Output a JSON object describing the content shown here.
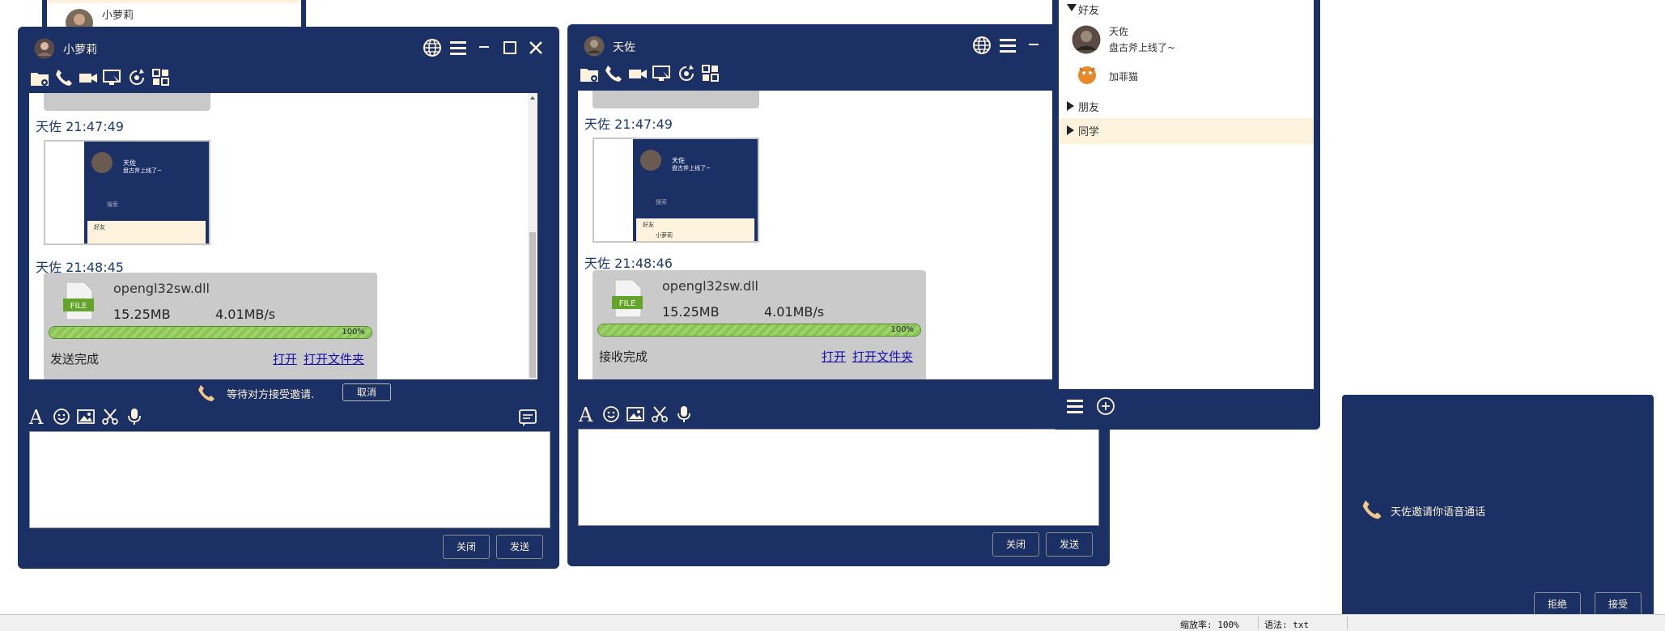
{
  "background_window": {
    "contact_name": "小萝莉"
  },
  "chat_left": {
    "title": "小萝莉",
    "messages": [
      {
        "sender_time": "天佐 21:47:49"
      },
      {
        "sender_time": "天佐 21:48:45"
      }
    ],
    "file": {
      "name": "opengl32sw.dll",
      "size": "15.25MB",
      "speed": "4.01MB/s",
      "progress_label": "100%",
      "progress": 1.0,
      "status": "发送完成",
      "open_label": "打开",
      "open_folder_label": "打开文件夹",
      "badge": "FILE"
    },
    "call_status": "等待对方接受邀请.",
    "cancel_label": "取消",
    "close_label": "关闭",
    "send_label": "发送"
  },
  "chat_right": {
    "title": "天佐",
    "messages": [
      {
        "sender_time": "天佐 21:47:49"
      },
      {
        "sender_time": "天佐 21:48:46"
      }
    ],
    "file": {
      "name": "opengl32sw.dll",
      "size": "15.25MB",
      "speed": "4.01MB/s",
      "progress_label": "100%",
      "progress": 1.0,
      "status": "接收完成",
      "open_label": "打开",
      "open_folder_label": "打开文件夹",
      "badge": "FILE"
    },
    "close_label": "关闭",
    "send_label": "发送"
  },
  "thumbnail": {
    "name": "天佐",
    "signature": "盘古斧上线了~",
    "search": "搜索",
    "group": "好友",
    "contact": "小萝莉"
  },
  "friends": {
    "groups": [
      {
        "name": "好友",
        "expanded": true
      },
      {
        "name": "朋友",
        "expanded": false
      },
      {
        "name": "同学",
        "expanded": false
      }
    ],
    "contacts": [
      {
        "name": "天佐",
        "signature": "盘古斧上线了~"
      },
      {
        "name": "加菲猫",
        "signature": ""
      }
    ]
  },
  "invite": {
    "message": "天佐邀请你语音通话",
    "reject_label": "拒绝",
    "accept_label": "接受"
  },
  "status_bar": {
    "zoom": "缩放率: 100%",
    "syntax": "语法: txt"
  },
  "colors": {
    "navy": "#1b3064",
    "cream": "#fdf3dc",
    "progress_green": "#8ac456"
  }
}
